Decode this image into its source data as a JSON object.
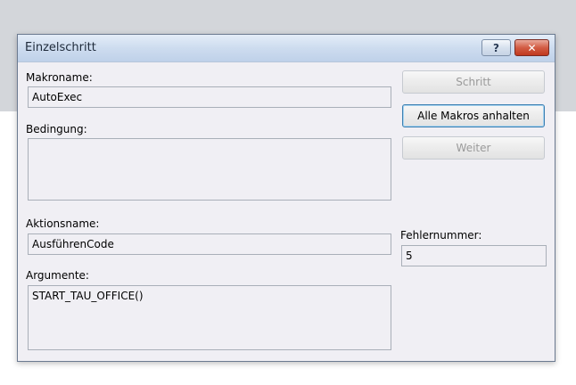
{
  "window": {
    "title": "Einzelschritt"
  },
  "titlebar": {
    "help_label": "?",
    "close_label": "✕"
  },
  "form": {
    "macro_name_label": "Makroname:",
    "macro_name_value": "AutoExec",
    "condition_label": "Bedingung:",
    "condition_value": "",
    "action_name_label": "Aktionsname:",
    "action_name_value": "AusführenCode",
    "arguments_label": "Argumente:",
    "arguments_value": "START_TAU_OFFICE()",
    "error_number_label": "Fehlernummer:",
    "error_number_value": "5"
  },
  "buttons": {
    "step": {
      "label": "Schritt",
      "enabled": false
    },
    "stop_all": {
      "label": "Alle Makros anhalten",
      "enabled": true
    },
    "continue": {
      "label": "Weiter",
      "enabled": false
    }
  }
}
